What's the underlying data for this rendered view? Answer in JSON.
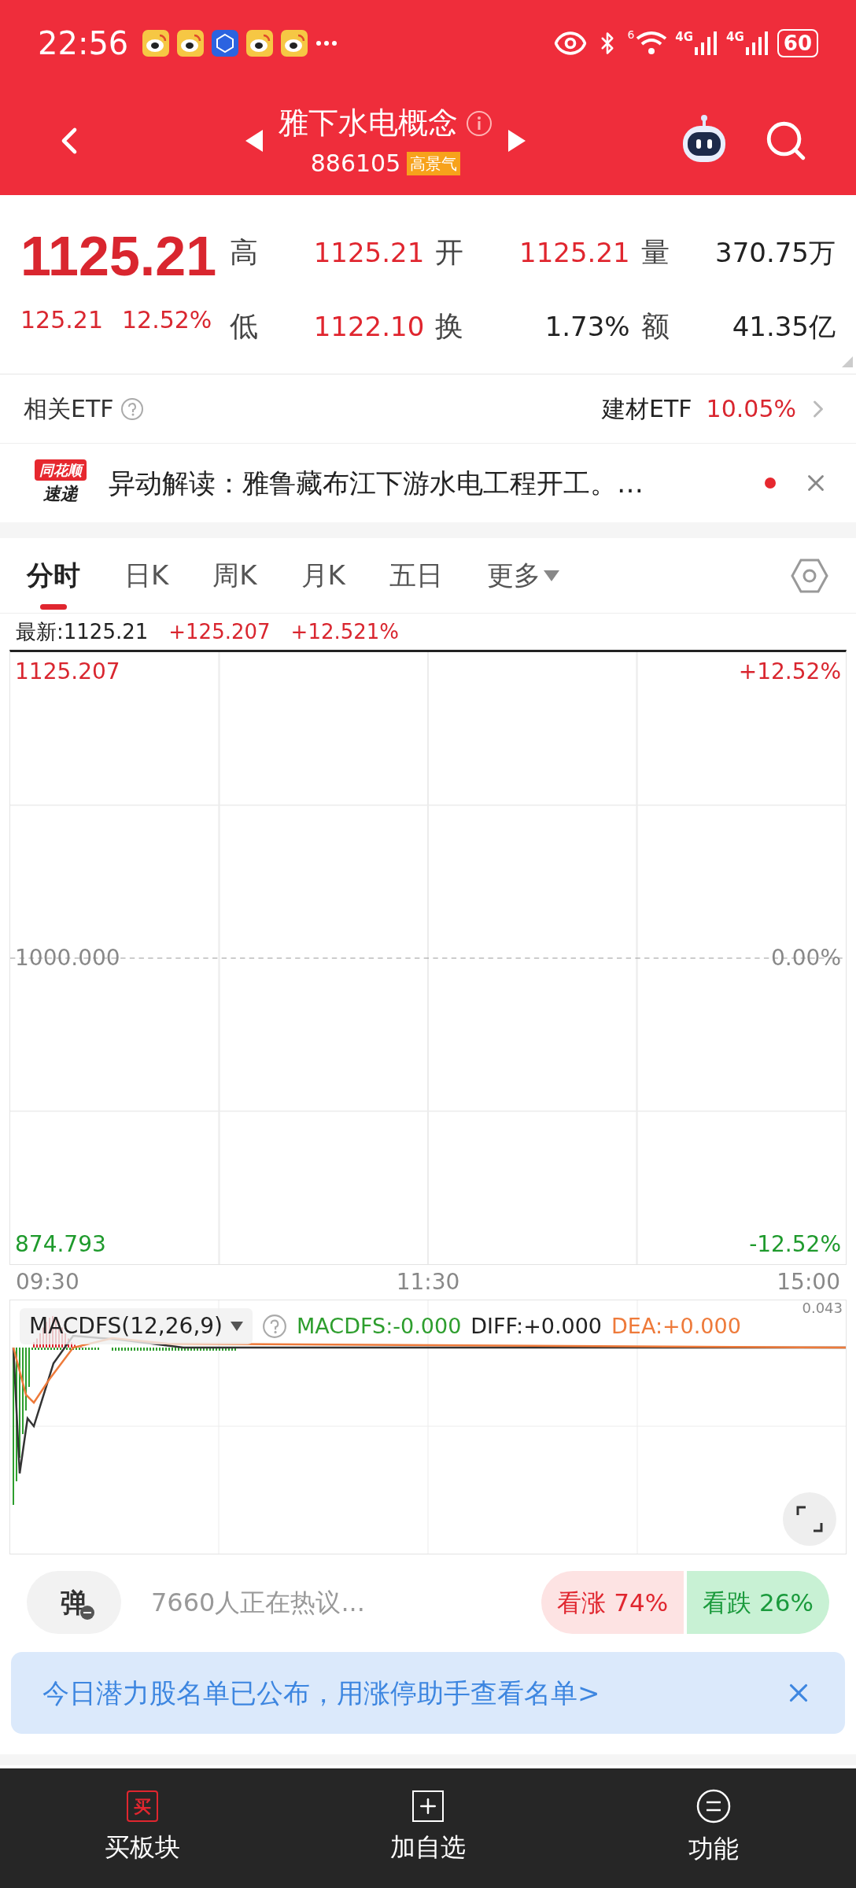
{
  "status_bar": {
    "time": "22:56",
    "signal_1": "4G",
    "signal_2": "4G",
    "wifi_badge": "6",
    "battery": "60"
  },
  "header": {
    "title": "雅下水电概念",
    "code": "886105",
    "tag": "高景气"
  },
  "quote": {
    "price": "1125.21",
    "change": "125.21",
    "change_pct": "12.52%",
    "stats": [
      {
        "label": "高",
        "value": "1125.21",
        "color": "#e0262f"
      },
      {
        "label": "开",
        "value": "1125.21",
        "color": "#e0262f"
      },
      {
        "label": "量",
        "value": "370.75万",
        "color": "#222222"
      },
      {
        "label": "低",
        "value": "1122.10",
        "color": "#e0262f"
      },
      {
        "label": "换",
        "value": "1.73%",
        "color": "#222222"
      },
      {
        "label": "额",
        "value": "41.35亿",
        "color": "#222222"
      }
    ]
  },
  "etf": {
    "label": "相关ETF",
    "name": "建材ETF",
    "change": "10.05%"
  },
  "news": {
    "logo_top": "同花顺",
    "logo_bottom": "速递",
    "text": "异动解读：雅鲁藏布江下游水电工程开工。…",
    "unread": true
  },
  "tabs": [
    {
      "label": "分时",
      "selected": true,
      "kind": "tab"
    },
    {
      "label": "日K",
      "selected": false,
      "kind": "tab"
    },
    {
      "label": "周K",
      "selected": false,
      "kind": "tab"
    },
    {
      "label": "月K",
      "selected": false,
      "kind": "tab"
    },
    {
      "label": "五日",
      "selected": false,
      "kind": "tab"
    },
    {
      "label": "更多",
      "selected": false,
      "kind": "menu"
    }
  ],
  "chart": {
    "latest": "最新:1125.21",
    "change": "+125.207",
    "change_pct": "+12.521%",
    "y_left": [
      {
        "text": "1125.207",
        "color": "#d9262f"
      },
      {
        "text": "1000.000",
        "color": "#888888"
      },
      {
        "text": "874.793",
        "color": "#1e9a2c"
      }
    ],
    "y_right": [
      {
        "text": "+12.52%",
        "color": "#d9262f"
      },
      {
        "text": "0.00%",
        "color": "#888888"
      },
      {
        "text": "-12.52%",
        "color": "#1e9a2c"
      }
    ],
    "x_labels": [
      "09:30",
      "11:30",
      "15:00"
    ]
  },
  "macd": {
    "indicator": "MACDFS(12,26,9)",
    "axis": "0.043",
    "values": [
      {
        "text": "MACDFS:-0.000",
        "color": "#2e9e2e"
      },
      {
        "text": "DIFF:+0.000",
        "color": "#222222"
      },
      {
        "text": "DEA:+0.000",
        "color": "#ee7a3a"
      }
    ]
  },
  "discussion": {
    "button": "弹",
    "text": "7660人正在热议...",
    "bull": "看涨 74%",
    "bear": "看跌 26%"
  },
  "banner": {
    "text": "今日潜力股名单已公布，用涨停助手查看名单>"
  },
  "nav": [
    {
      "label": "买板块",
      "kind": "buy",
      "icon_text": "买"
    },
    {
      "label": "加自选",
      "kind": "add"
    },
    {
      "label": "功能",
      "kind": "menu"
    }
  ]
}
